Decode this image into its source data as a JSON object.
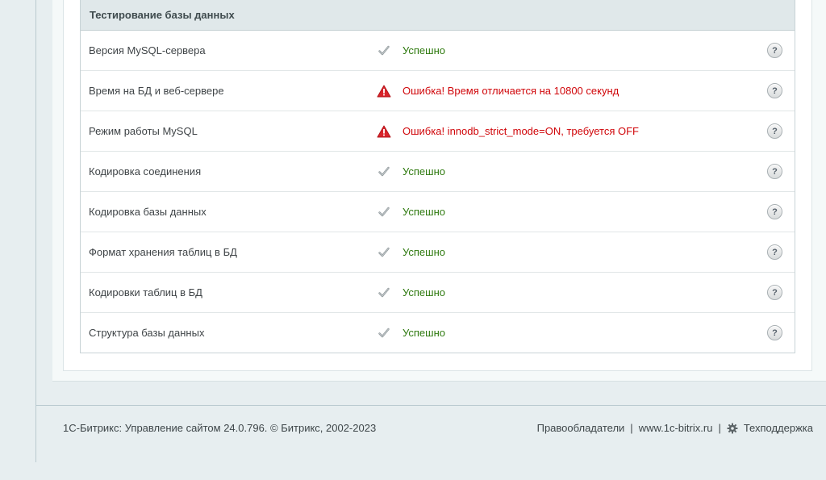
{
  "section": {
    "title": "Тестирование базы данных"
  },
  "rows": [
    {
      "label": "Версия MySQL-сервера",
      "status": "ok",
      "status_icon": "checkmark-icon",
      "message": "Успешно"
    },
    {
      "label": "Время на БД и веб-сервере",
      "status": "error",
      "status_icon": "warning-triangle-icon",
      "message": "Ошибка! Время отличается на 10800 секунд"
    },
    {
      "label": "Режим работы MySQL",
      "status": "error",
      "status_icon": "warning-triangle-icon",
      "message": "Ошибка! innodb_strict_mode=ON, требуется OFF"
    },
    {
      "label": "Кодировка соединения",
      "status": "ok",
      "status_icon": "checkmark-icon",
      "message": "Успешно"
    },
    {
      "label": "Кодировка базы данных",
      "status": "ok",
      "status_icon": "checkmark-icon",
      "message": "Успешно"
    },
    {
      "label": "Формат хранения таблиц в БД",
      "status": "ok",
      "status_icon": "checkmark-icon",
      "message": "Успешно"
    },
    {
      "label": "Кодировки таблиц в БД",
      "status": "ok",
      "status_icon": "checkmark-icon",
      "message": "Успешно"
    },
    {
      "label": "Структура базы данных",
      "status": "ok",
      "status_icon": "checkmark-icon",
      "message": "Успешно"
    }
  ],
  "help_label": "?",
  "footer": {
    "copyright": "1С-Битрикс: Управление сайтом 24.0.796. © Битрикс, 2002-2023",
    "links": {
      "rights": "Правообладатели",
      "separator": "|",
      "site": "www.1c-bitrix.ru",
      "support": "Техподдержка"
    }
  },
  "colors": {
    "success": "#2f7a0f",
    "error": "#d0060a",
    "header_bg": "#e0e8ea",
    "page_bg": "#e7eef0"
  }
}
